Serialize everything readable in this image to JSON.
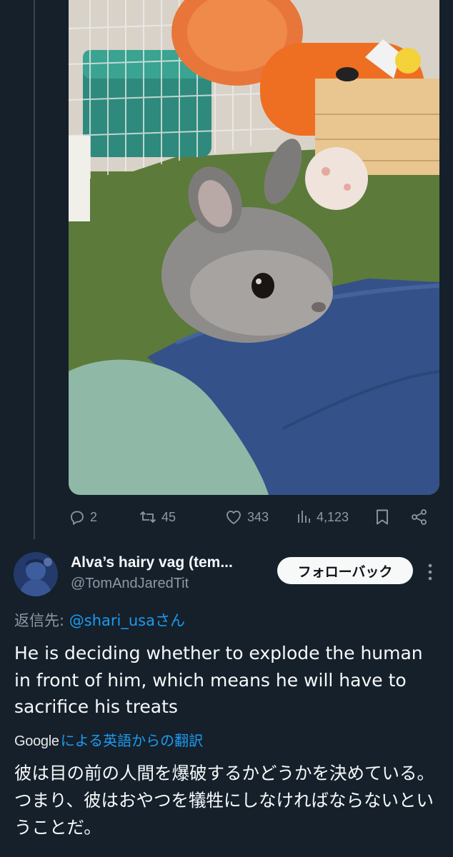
{
  "media": {
    "alt": "rabbit photo",
    "colors": {
      "floor": "#5d7a3a",
      "jeans": "#34518a",
      "sleeve": "#8fb8a6",
      "rabbit": "#8c8a88"
    }
  },
  "actions": {
    "replies": "2",
    "retweets": "45",
    "likes": "343",
    "views": "4,123"
  },
  "author": {
    "display_name": "Alva’s hairy vag (tem...",
    "handle": "@TomAndJaredTit",
    "follow_label": "フォローバック"
  },
  "reply_to": {
    "label": "返信先: ",
    "mention": "@shari_usaさん"
  },
  "tweet": {
    "text": "He is deciding whether to explode the human in front of him, which means he will have to sacrifice his treats"
  },
  "translation": {
    "provider": "Google",
    "link": "による英語からの翻訳",
    "text": "彼は目の前の人間を爆破するかどうかを決めている。つまり、彼はおやつを犠牲にしなければならないということだ。"
  },
  "icons": {
    "reply": "reply-icon",
    "retweet": "retweet-icon",
    "like": "heart-icon",
    "views": "views-icon",
    "bookmark": "bookmark-icon",
    "share": "share-icon",
    "more": "more-icon"
  },
  "theme": {
    "background": "#15202b",
    "accent": "#1d9bf0",
    "muted": "#8b98a5",
    "text": "#f7f9f9"
  }
}
